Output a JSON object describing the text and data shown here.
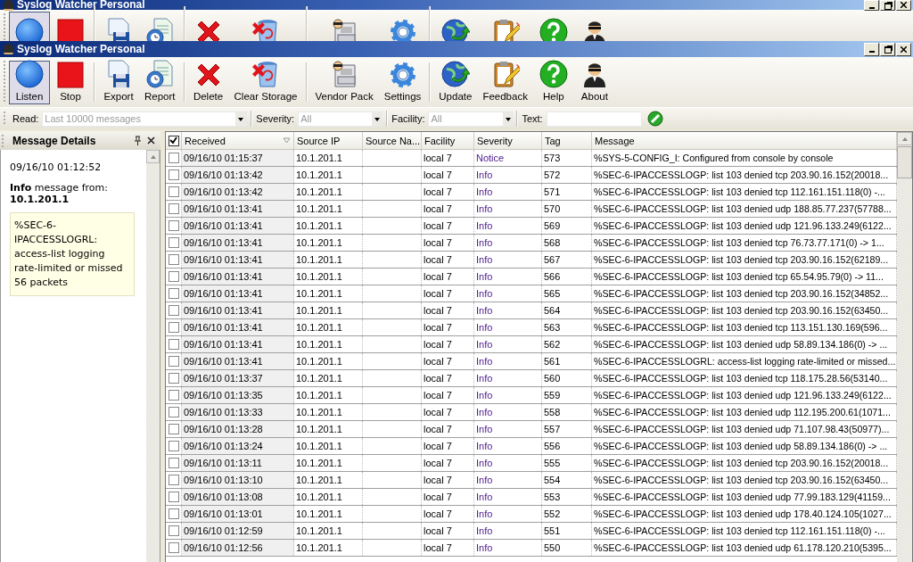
{
  "background_window": {
    "title": "Syslog Watcher Personal"
  },
  "window": {
    "title": "Syslog Watcher Personal"
  },
  "toolbar": {
    "groups": [
      [
        {
          "label": "Listen",
          "kind": "listen",
          "selected": true
        },
        {
          "label": "Stop",
          "kind": "stop",
          "selected": false
        }
      ],
      [
        {
          "label": "Export",
          "kind": "export",
          "selected": false
        },
        {
          "label": "Report",
          "kind": "report",
          "selected": false
        }
      ],
      [
        {
          "label": "Delete",
          "kind": "delete",
          "selected": false
        },
        {
          "label": "Clear Storage",
          "kind": "clear",
          "selected": false
        }
      ],
      [
        {
          "label": "Vendor Pack",
          "kind": "vendor",
          "selected": false
        },
        {
          "label": "Settings",
          "kind": "settings",
          "selected": false
        }
      ],
      [
        {
          "label": "Update",
          "kind": "update",
          "selected": false
        },
        {
          "label": "Feedback",
          "kind": "feedback",
          "selected": false
        },
        {
          "label": "Help",
          "kind": "help",
          "selected": false
        },
        {
          "label": "About",
          "kind": "about",
          "selected": false
        }
      ]
    ]
  },
  "filter_bar": {
    "read": {
      "label": "Read:",
      "placeholder": "Last 10000 messages"
    },
    "severity": {
      "label": "Severity:",
      "placeholder": "All"
    },
    "facility": {
      "label": "Facility:",
      "placeholder": "All"
    },
    "text": {
      "label": "Text:"
    }
  },
  "details_panel": {
    "title": "Message Details",
    "time": "09/16/10 01:12:52",
    "summary": "**Info** message from:",
    "source": "10.1.201.1",
    "message": "%SEC-6-IPACCESSLOGRL: access-list logging rate-limited or missed 56 packets"
  },
  "table": {
    "all_checked": true,
    "columns": [
      "Received",
      "Source IP",
      "Source Na...",
      "Facility",
      "Severity",
      "Tag",
      "Message"
    ],
    "rows": [
      {
        "checked": false,
        "cells": [
          "09/16/10 01:15:37",
          "10.1.201.1",
          "",
          "local 7",
          "Notice",
          "573",
          "%SYS-5-CONFIG_I: Configured from console by console"
        ]
      },
      {
        "checked": false,
        "cells": [
          "09/16/10 01:13:42",
          "10.1.201.1",
          "",
          "local 7",
          "Info",
          "572",
          "%SEC-6-IPACCESSLOGP: list 103 denied tcp 203.90.16.152(20018..."
        ]
      },
      {
        "checked": false,
        "cells": [
          "09/16/10 01:13:42",
          "10.1.201.1",
          "",
          "local 7",
          "Info",
          "571",
          "%SEC-6-IPACCESSLOGP: list 103 denied tcp 112.161.151.118(0) -..."
        ]
      },
      {
        "checked": false,
        "cells": [
          "09/16/10 01:13:41",
          "10.1.201.1",
          "",
          "local 7",
          "Info",
          "570",
          "%SEC-6-IPACCESSLOGP: list 103 denied udp 188.85.77.237(57788..."
        ]
      },
      {
        "checked": false,
        "cells": [
          "09/16/10 01:13:41",
          "10.1.201.1",
          "",
          "local 7",
          "Info",
          "569",
          "%SEC-6-IPACCESSLOGP: list 103 denied udp 121.96.133.249(6122..."
        ]
      },
      {
        "checked": false,
        "cells": [
          "09/16/10 01:13:41",
          "10.1.201.1",
          "",
          "local 7",
          "Info",
          "568",
          "%SEC-6-IPACCESSLOGP: list 103 denied tcp 76.73.77.171(0) -> 1..."
        ]
      },
      {
        "checked": false,
        "cells": [
          "09/16/10 01:13:41",
          "10.1.201.1",
          "",
          "local 7",
          "Info",
          "567",
          "%SEC-6-IPACCESSLOGP: list 103 denied tcp 203.90.16.152(62189..."
        ]
      },
      {
        "checked": false,
        "cells": [
          "09/16/10 01:13:41",
          "10.1.201.1",
          "",
          "local 7",
          "Info",
          "566",
          "%SEC-6-IPACCESSLOGP: list 103 denied tcp 65.54.95.79(0) -> 11..."
        ]
      },
      {
        "checked": false,
        "cells": [
          "09/16/10 01:13:41",
          "10.1.201.1",
          "",
          "local 7",
          "Info",
          "565",
          "%SEC-6-IPACCESSLOGP: list 103 denied tcp 203.90.16.152(34852..."
        ]
      },
      {
        "checked": false,
        "cells": [
          "09/16/10 01:13:41",
          "10.1.201.1",
          "",
          "local 7",
          "Info",
          "564",
          "%SEC-6-IPACCESSLOGP: list 103 denied tcp 203.90.16.152(63450..."
        ]
      },
      {
        "checked": false,
        "cells": [
          "09/16/10 01:13:41",
          "10.1.201.1",
          "",
          "local 7",
          "Info",
          "563",
          "%SEC-6-IPACCESSLOGP: list 103 denied tcp 113.151.130.169(596..."
        ]
      },
      {
        "checked": false,
        "cells": [
          "09/16/10 01:13:41",
          "10.1.201.1",
          "",
          "local 7",
          "Info",
          "562",
          "%SEC-6-IPACCESSLOGP: list 103 denied udp 58.89.134.186(0) -> ..."
        ]
      },
      {
        "checked": false,
        "cells": [
          "09/16/10 01:13:41",
          "10.1.201.1",
          "",
          "local 7",
          "Info",
          "561",
          "%SEC-6-IPACCESSLOGRL: access-list logging rate-limited or missed..."
        ]
      },
      {
        "checked": false,
        "cells": [
          "09/16/10 01:13:37",
          "10.1.201.1",
          "",
          "local 7",
          "Info",
          "560",
          "%SEC-6-IPACCESSLOGP: list 103 denied tcp 118.175.28.56(53140..."
        ]
      },
      {
        "checked": false,
        "cells": [
          "09/16/10 01:13:35",
          "10.1.201.1",
          "",
          "local 7",
          "Info",
          "559",
          "%SEC-6-IPACCESSLOGP: list 103 denied udp 121.96.133.249(6122..."
        ]
      },
      {
        "checked": false,
        "cells": [
          "09/16/10 01:13:33",
          "10.1.201.1",
          "",
          "local 7",
          "Info",
          "558",
          "%SEC-6-IPACCESSLOGP: list 103 denied udp 112.195.200.61(1071..."
        ]
      },
      {
        "checked": false,
        "cells": [
          "09/16/10 01:13:28",
          "10.1.201.1",
          "",
          "local 7",
          "Info",
          "557",
          "%SEC-6-IPACCESSLOGP: list 103 denied udp 71.107.98.43(50977)..."
        ]
      },
      {
        "checked": false,
        "cells": [
          "09/16/10 01:13:24",
          "10.1.201.1",
          "",
          "local 7",
          "Info",
          "556",
          "%SEC-6-IPACCESSLOGP: list 103 denied udp 58.89.134.186(0) -> ..."
        ]
      },
      {
        "checked": false,
        "cells": [
          "09/16/10 01:13:11",
          "10.1.201.1",
          "",
          "local 7",
          "Info",
          "555",
          "%SEC-6-IPACCESSLOGP: list 103 denied tcp 203.90.16.152(20018..."
        ]
      },
      {
        "checked": false,
        "cells": [
          "09/16/10 01:13:10",
          "10.1.201.1",
          "",
          "local 7",
          "Info",
          "554",
          "%SEC-6-IPACCESSLOGP: list 103 denied tcp 203.90.16.152(63450..."
        ]
      },
      {
        "checked": false,
        "cells": [
          "09/16/10 01:13:08",
          "10.1.201.1",
          "",
          "local 7",
          "Info",
          "553",
          "%SEC-6-IPACCESSLOGP: list 103 denied udp 77.99.183.129(41159..."
        ]
      },
      {
        "checked": false,
        "cells": [
          "09/16/10 01:13:01",
          "10.1.201.1",
          "",
          "local 7",
          "Info",
          "552",
          "%SEC-6-IPACCESSLOGP: list 103 denied udp 178.40.124.105(1027..."
        ]
      },
      {
        "checked": false,
        "cells": [
          "09/16/10 01:12:59",
          "10.1.201.1",
          "",
          "local 7",
          "Info",
          "551",
          "%SEC-6-IPACCESSLOGP: list 103 denied tcp 112.161.151.118(0) -..."
        ]
      },
      {
        "checked": false,
        "cells": [
          "09/16/10 01:12:56",
          "10.1.201.1",
          "",
          "local 7",
          "Info",
          "550",
          "%SEC-6-IPACCESSLOGP: list 103 denied udp 61.178.120.210(5395..."
        ]
      }
    ]
  }
}
